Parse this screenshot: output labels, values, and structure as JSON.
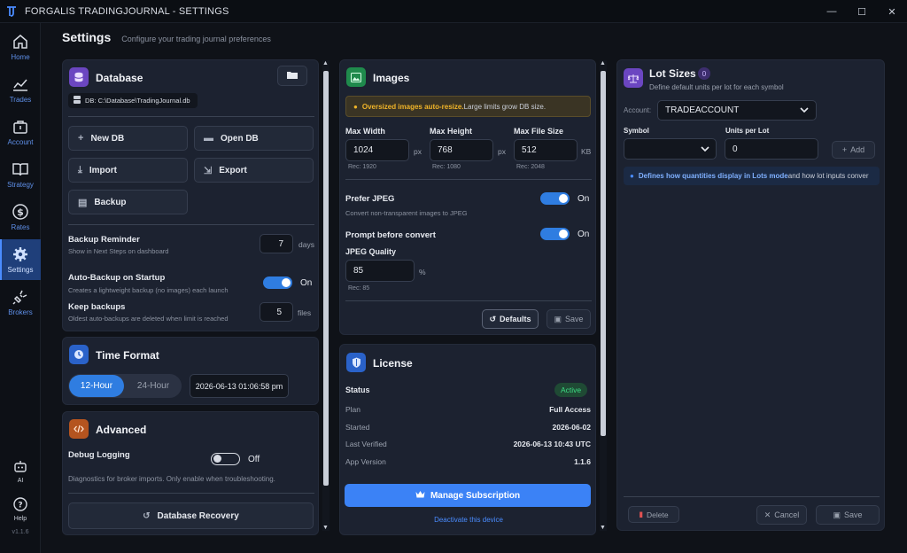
{
  "window": {
    "title": "FORGALIS TRADINGJOURNAL - SETTINGS",
    "minimize": "—",
    "maximize": "☐",
    "close": "✕"
  },
  "sidebar": {
    "items": [
      {
        "label": "Home",
        "icon": "home-icon"
      },
      {
        "label": "Trades",
        "icon": "chart-line-icon"
      },
      {
        "label": "Account",
        "icon": "briefcase-icon"
      },
      {
        "label": "Strategy",
        "icon": "book-icon"
      },
      {
        "label": "Rates",
        "icon": "dollar-icon"
      },
      {
        "label": "Settings",
        "icon": "gear-icon"
      },
      {
        "label": "Brokers",
        "icon": "plug-icon"
      }
    ],
    "ai_label": "AI",
    "help_label": "Help",
    "version": "v1.1.6"
  },
  "header": {
    "title": "Settings",
    "subtitle": "Configure your trading journal preferences"
  },
  "database": {
    "title": "Database",
    "path": "DB: C:\\Database\\TradingJournal.db",
    "new_db": "New DB",
    "open_db": "Open DB",
    "import": "Import",
    "export": "Export",
    "backup": "Backup",
    "reminder_label": "Backup Reminder",
    "reminder_sub": "Show in Next Steps on dashboard",
    "reminder_value": "7",
    "reminder_unit": "days",
    "auto_label": "Auto-Backup on Startup",
    "auto_sub": "Creates a lightweight backup (no images) each launch",
    "auto_state": "On",
    "keep_label": "Keep backups",
    "keep_sub": "Oldest auto-backups are deleted when limit is reached",
    "keep_value": "5",
    "keep_unit": "files"
  },
  "time_format": {
    "title": "Time Format",
    "opt1": "12-Hour",
    "opt2": "24-Hour",
    "preview": "2026-06-13 01:06:58 pm"
  },
  "advanced": {
    "title": "Advanced",
    "debug_label": "Debug Logging",
    "debug_state": "Off",
    "debug_sub": "Diagnostics for broker imports. Only enable when troubleshooting.",
    "recovery": "Database Recovery"
  },
  "images": {
    "title": "Images",
    "warn_bold": "Oversized images auto-resize.",
    "warn_rest": " Large limits grow DB size.",
    "max_width_label": "Max Width",
    "max_width": "1024",
    "max_width_unit": "px",
    "max_width_rec": "Rec: 1920",
    "max_height_label": "Max Height",
    "max_height": "768",
    "max_height_unit": "px",
    "max_height_rec": "Rec: 1080",
    "max_size_label": "Max File Size",
    "max_size": "512",
    "max_size_unit": "KB",
    "max_size_rec": "Rec: 2048",
    "jpeg_label": "Prefer JPEG",
    "jpeg_state": "On",
    "jpeg_sub": "Convert non-transparent images to JPEG",
    "prompt_label": "Prompt before convert",
    "prompt_state": "On",
    "quality_label": "JPEG Quality",
    "quality": "85",
    "quality_unit": "%",
    "quality_rec": "Rec: 85",
    "defaults": "Defaults",
    "save": "Save"
  },
  "license": {
    "title": "License",
    "status_label": "Status",
    "status": "Active",
    "rows": [
      {
        "k": "Plan",
        "v": "Full Access"
      },
      {
        "k": "Started",
        "v": "2026-06-02"
      },
      {
        "k": "Last Verified",
        "v": "2026-06-13 10:43 UTC"
      },
      {
        "k": "App Version",
        "v": "1.1.6"
      }
    ],
    "manage": "Manage Subscription",
    "deactivate": "Deactivate this device"
  },
  "lots": {
    "title": "Lot Sizes",
    "count": "0",
    "subtitle": "Define default units per lot for each symbol",
    "account_label": "Account:",
    "account_value": "TRADEACCOUNT",
    "symbol_label": "Symbol",
    "units_label": "Units per Lot",
    "units_value": "0",
    "add": "Add",
    "info_bold": "Defines how quantities display in Lots mode",
    "info_rest": " and how lot inputs conver",
    "delete": "Delete",
    "cancel": "Cancel",
    "save": "Save"
  },
  "colors": {
    "accent": "#2f7de1",
    "success": "#3ddc84",
    "warn": "#f0b429"
  }
}
